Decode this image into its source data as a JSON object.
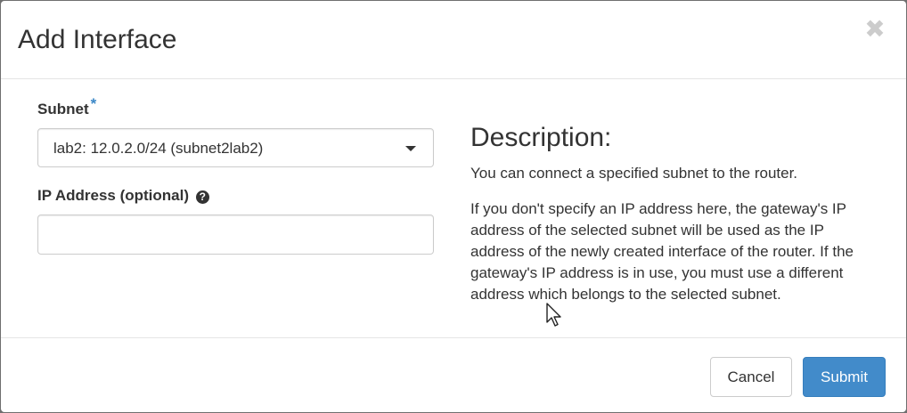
{
  "dialog": {
    "title": "Add Interface",
    "close_icon": "close-icon",
    "close_symbol": "✖"
  },
  "form": {
    "subnet": {
      "label": "Subnet",
      "required_marker": "*",
      "selected_value": "lab2: 12.0.2.0/24 (subnet2lab2)"
    },
    "ip_address": {
      "label": "IP Address (optional)",
      "help_icon": "question-circle-icon",
      "help_symbol": "?",
      "value": "",
      "placeholder": ""
    }
  },
  "description": {
    "heading": "Description:",
    "paragraphs": [
      "You can connect a specified subnet to the router.",
      "If you don't specify an IP address here, the gateway's IP address of the selected subnet will be used as the IP address of the newly created interface of the router. If the gateway's IP address is in use, you must use a different address which belongs to the selected subnet."
    ]
  },
  "footer": {
    "cancel_label": "Cancel",
    "submit_label": "Submit"
  },
  "colors": {
    "primary": "#428bca",
    "required": "#3a87c7",
    "backdrop": "#6f6f6f"
  }
}
